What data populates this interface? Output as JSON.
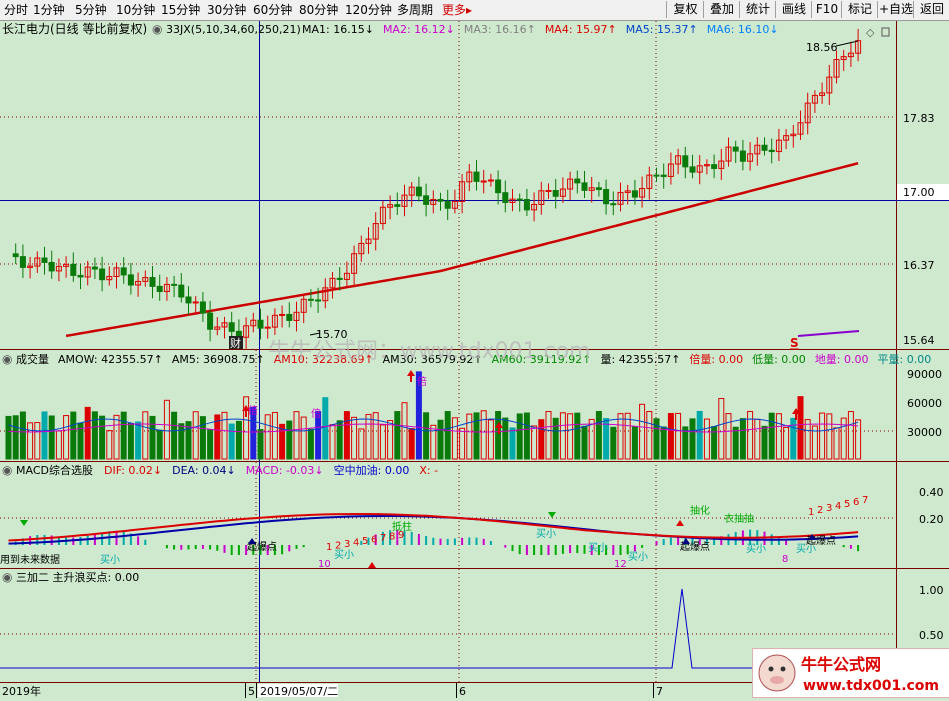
{
  "toolbar": {
    "periods": [
      "分时",
      "1分钟",
      "5分钟",
      "10分钟",
      "15分钟",
      "30分钟",
      "60分钟",
      "80分钟",
      "120分钟",
      "多周期"
    ],
    "more": "更多",
    "more_arrow": "▸",
    "right_buttons": [
      "复权",
      "叠加",
      "统计",
      "画线",
      "F10",
      "标记",
      "+自选",
      "返回"
    ]
  },
  "main": {
    "stock": "长江电力(日线 等比前复权)",
    "indicator": "33JX(5,10,34,60,250,21)",
    "ma": [
      {
        "label": "MA1: 16.15",
        "arrow": "↓",
        "color": "#000000"
      },
      {
        "label": "MA2: 16.12",
        "arrow": "↓",
        "color": "#cc00cc"
      },
      {
        "label": "MA3: 16.16",
        "arrow": "↑",
        "color": "#808080"
      },
      {
        "label": "MA4: 15.97",
        "arrow": "↑",
        "color": "#dd0000"
      },
      {
        "label": "MA5: 15.37",
        "arrow": "↑",
        "color": "#0044cc"
      },
      {
        "label": "MA6: 16.10",
        "arrow": "↓",
        "color": "#0080ff"
      }
    ],
    "y_ticks": [
      "17.83",
      "17.00",
      "16.37",
      "15.64"
    ],
    "high_label": "18.56",
    "low_label": "15.70",
    "cai_badge": "财",
    "s_badge": "S"
  },
  "volume": {
    "title": "成交量",
    "labels": [
      {
        "text": "AMOW: 42355.57",
        "arrow": "↑",
        "color": "#000000"
      },
      {
        "text": "AM5: 36908.75",
        "arrow": "↑",
        "color": "#000000"
      },
      {
        "text": "AM10: 32238.69",
        "arrow": "↑",
        "color": "#dd0000"
      },
      {
        "text": "AM30: 36579.92",
        "arrow": "↑",
        "color": "#000000"
      },
      {
        "text": "AM60: 39119.92",
        "arrow": "↑",
        "color": "#008800"
      },
      {
        "text": "量: 42355.57",
        "arrow": "↑",
        "color": "#000000"
      },
      {
        "text": "倍量: 0.00",
        "arrow": "",
        "color": "#dd0000"
      },
      {
        "text": "低量: 0.00",
        "arrow": "",
        "color": "#008800"
      },
      {
        "text": "地量: 0.00",
        "arrow": "",
        "color": "#cc00cc"
      },
      {
        "text": "平量: 0.00",
        "arrow": "",
        "color": "#008888"
      }
    ],
    "y_ticks": [
      "90000",
      "60000",
      "30000"
    ],
    "bei_labels": [
      "倍",
      "倍",
      "倍"
    ]
  },
  "macd": {
    "title": "MACD综合选股",
    "labels": [
      {
        "text": "DIF: 0.02",
        "arrow": "↓",
        "color": "#dd0000"
      },
      {
        "text": "DEA: 0.04",
        "arrow": "↓",
        "color": "#000080"
      },
      {
        "text": "MACD: -0.03",
        "arrow": "↓",
        "color": "#cc00cc"
      },
      {
        "text": "空中加油: 0.00",
        "arrow": "",
        "color": "#0000cc"
      },
      {
        "text": "X: -",
        "arrow": "",
        "color": "#dd0000"
      }
    ],
    "y_ticks": [
      "0.40",
      "0.20"
    ],
    "future_note": "用到未来数据",
    "annotations": {
      "buy_small": "买小",
      "qibaodian": "起爆点",
      "dizhu": "抵柱",
      "chuhua": "抽化",
      "yicuo": "衣抽抽",
      "numbers_1": [
        "1",
        "2",
        "3",
        "4",
        "5",
        "6",
        "7",
        "8",
        "9"
      ],
      "numbers_2": [
        "1",
        "2",
        "3",
        "4",
        "5",
        "6",
        "7"
      ],
      "n10": "10",
      "n12": "12",
      "n8": "8"
    }
  },
  "bottom": {
    "title": "三加二 主升浪买点: 0.00",
    "y_ticks": [
      "1.00",
      "0.50"
    ]
  },
  "dates": {
    "year": "2019年",
    "m5": "5",
    "cursor_date": "2019/05/07/二",
    "m6": "6",
    "m7": "7"
  },
  "watermark": "牛牛公式网：www.tdx001.com",
  "logo": {
    "title": "牛牛公式网",
    "url": "www.tdx001.com"
  },
  "colors": {
    "bg": "#cfe9cf",
    "up": "#dd0000",
    "down": "#0a7a0a",
    "ma_red": "#cc0000",
    "ma_blue": "#1060c0"
  }
}
